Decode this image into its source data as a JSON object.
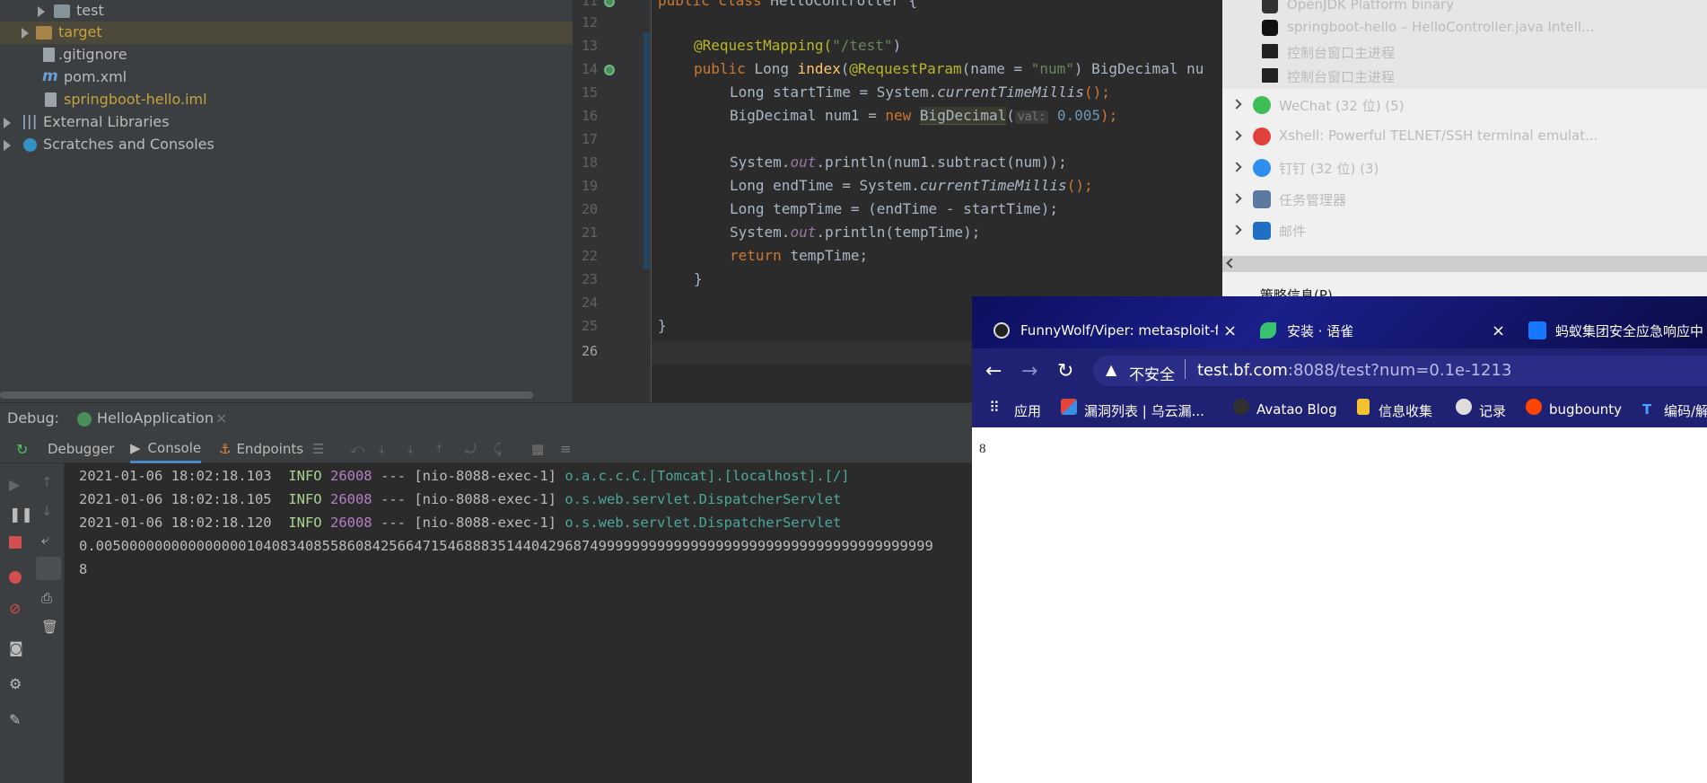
{
  "project_tree": {
    "items": [
      {
        "label": "test",
        "kind": "folder"
      },
      {
        "label": "target",
        "kind": "folder-excluded"
      },
      {
        "label": ".gitignore",
        "kind": "file"
      },
      {
        "label": "pom.xml",
        "kind": "maven"
      },
      {
        "label": "springboot-hello.iml",
        "kind": "module-file"
      },
      {
        "label": "External Libraries",
        "kind": "libraries"
      },
      {
        "label": "Scratches and Consoles",
        "kind": "scratches"
      }
    ]
  },
  "editor": {
    "line_numbers": [
      "11",
      "12",
      "13",
      "14",
      "15",
      "16",
      "17",
      "18",
      "19",
      "20",
      "21",
      "22",
      "23",
      "24",
      "25",
      "26"
    ],
    "current_line": "26",
    "lines": {
      "l11": [
        "public class ",
        "HelloController {"
      ],
      "l13": [
        "@RequestMapping(",
        "\"/test\"",
        ")"
      ],
      "l14": [
        "public ",
        "Long ",
        "index",
        "(",
        "@RequestParam",
        "(name = ",
        "\"num\"",
        ") BigDecimal nu"
      ],
      "l15": [
        "Long startTime = System.",
        "currentTimeMillis",
        "();"
      ],
      "l16": [
        "BigDecimal num1 = ",
        "new ",
        "BigDecimal",
        "(",
        "val:",
        " 0.005",
        ");"
      ],
      "l18": [
        "System.",
        "out",
        ".println(num1.subtract(num));"
      ],
      "l19": [
        "Long endTime = System.",
        "currentTimeMillis",
        "();"
      ],
      "l20": [
        "Long tempTime = (endTime - startTime);"
      ],
      "l21": [
        "System.",
        "out",
        ".println(tempTime);"
      ],
      "l22": [
        "return ",
        "tempTime;"
      ],
      "l23": [
        "}"
      ],
      "l25": [
        "}"
      ]
    }
  },
  "taskbar_popup": {
    "subitems": [
      {
        "label": "OpenJDK Platform binary",
        "icon": "java-icon"
      },
      {
        "label": "springboot-hello – HelloController.java Intell...",
        "icon": "intellij-icon"
      },
      {
        "label": "控制台窗口主进程",
        "icon": "console-icon"
      },
      {
        "label": "控制台窗口主进程",
        "icon": "console-icon"
      }
    ],
    "groups": [
      {
        "label": "WeChat (32 位) (5)",
        "icon": "wechat-icon",
        "color": "#3dbd54"
      },
      {
        "label": "Xshell: Powerful TELNET/SSH terminal emulat...",
        "icon": "xshell-icon",
        "color": "#e0413b"
      },
      {
        "label": "钉钉 (32 位) (3)",
        "icon": "dingtalk-icon",
        "color": "#2f8ef0"
      },
      {
        "label": "任务管理器",
        "icon": "task-manager-icon",
        "color": "#5a7aa0"
      },
      {
        "label": "邮件",
        "icon": "mail-icon",
        "color": "#1f6fc5"
      }
    ],
    "partial": "策略信息(P)"
  },
  "debug": {
    "label": "Debug:",
    "config": "HelloApplication",
    "tabs": [
      "Debugger",
      "Console",
      "Endpoints"
    ],
    "active_tab": "Console",
    "console": [
      {
        "ts": "2021-01-06 18:02:18.103",
        "level": "INFO",
        "pid": "26008",
        "sep": "---",
        "thread": "[nio-8088-exec-1]",
        "logger": "o.a.c.c.C.[Tomcat].[localhost].[/]"
      },
      {
        "ts": "2021-01-06 18:02:18.105",
        "level": "INFO",
        "pid": "26008",
        "sep": "---",
        "thread": "[nio-8088-exec-1]",
        "logger": "o.s.web.servlet.DispatcherServlet"
      },
      {
        "ts": "2021-01-06 18:02:18.120",
        "level": "INFO",
        "pid": "26008",
        "sep": "---",
        "thread": "[nio-8088-exec-1]",
        "logger": "o.s.web.servlet.DispatcherServlet"
      }
    ],
    "output_lines": [
      "0.0050000000000000001040834085586084256647154688835144042968749999999999999999999999999999999999999999",
      "8"
    ]
  },
  "browser": {
    "tabs": [
      {
        "title": "FunnyWolf/Viper: metasploit-f",
        "icon": "github-icon"
      },
      {
        "title": "安装 · 语雀",
        "icon": "yuque-icon"
      },
      {
        "title": "蚂蚁集团安全应急响应中",
        "icon": "alipay-icon"
      }
    ],
    "security": "不安全",
    "url_host": "test.bf.com",
    "url_rest": ":8088/test?num=0.1e-1213",
    "bookmarks": [
      "应用",
      "漏洞列表 | 乌云漏...",
      "Avatao Blog",
      "信息收集",
      "记录",
      "bugbounty",
      "编码/解"
    ],
    "page_text": "8"
  }
}
